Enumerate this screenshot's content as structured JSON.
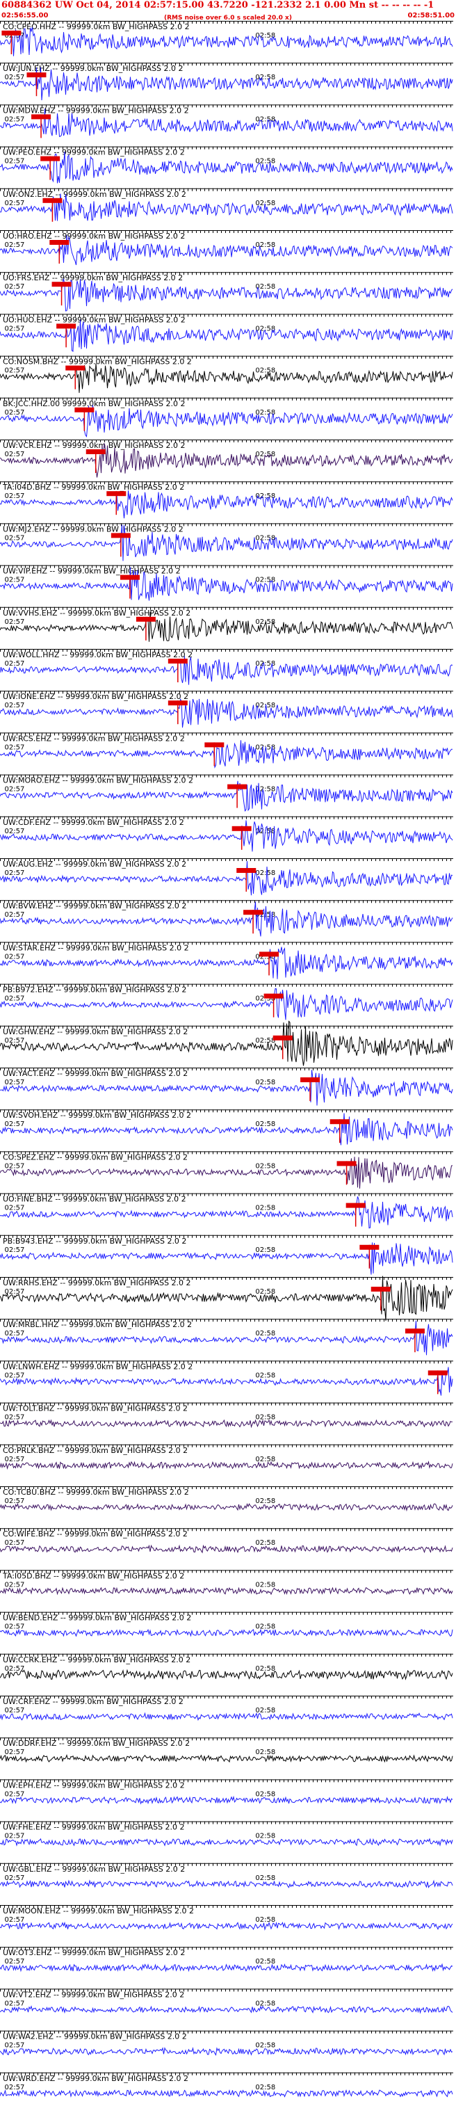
{
  "header": {
    "title": "60884362 UW Oct 04, 2014 02:57:15.00    43.7220 -121.2332  2.1 0.00 Mn st -- -- -- -- -1",
    "start_time": "02:56:55.00",
    "end_time": "02:58:51.00",
    "note": "(RMS noise over 6.0 s scaled 20.0 x)"
  },
  "colors": {
    "blue": "#1a1aff",
    "black": "#000000",
    "purple": "#3a1060",
    "pick": "#e00000",
    "grid": "#000000"
  },
  "chart_data": {
    "type": "line",
    "title": "60884362 UW Oct 04, 2014 02:57:15.00    43.7220 -121.2332  2.1 0.00 Mn st -- -- -- -- -1",
    "x_range": [
      "02:56:55.00",
      "02:58:51.00"
    ],
    "time_labels": [
      "02:57",
      "02:58"
    ],
    "series": [
      {
        "name": "COPREO",
        "label": "CO:CPEO.HHZ -- 99999.0km BW_HIGHPASS 2.0 2",
        "color": "blue",
        "pick_frac": 0.025
      },
      {
        "name": "UWJUN",
        "label": "UW:JUN.EHZ -- 99999.0km BW_HIGHPASS 2.0 2",
        "color": "blue",
        "pick_frac": 0.08
      },
      {
        "name": "UWMDW",
        "label": "UW:MDW.EHZ -- 99999.0km BW_HIGHPASS 2.0 2",
        "color": "blue",
        "pick_frac": 0.09
      },
      {
        "name": "UWPEO",
        "label": "UW:PEO.EHZ -- 99999.0km BW_HIGHPASS 2.0 2",
        "color": "blue",
        "pick_frac": 0.11
      },
      {
        "name": "UWON2",
        "label": "UW:ON2.EHZ -- 99999.0km BW_HIGHPASS 2.0 2",
        "color": "blue",
        "pick_frac": 0.115
      },
      {
        "name": "UOHRO",
        "label": "UO:HRO.EHZ -- 99999.0km BW_HIGHPASS 2.0 2",
        "color": "blue",
        "pick_frac": 0.13
      },
      {
        "name": "UOFRS",
        "label": "UO:FRS.EHZ -- 99999.0km BW_HIGHPASS 2.0 2",
        "color": "blue",
        "pick_frac": 0.135
      },
      {
        "name": "UOHUO",
        "label": "UO:HUO.EHZ -- 99999.0km BW_HIGHPASS 2.0 2",
        "color": "blue",
        "pick_frac": 0.145
      },
      {
        "name": "CONOSM",
        "label": "CO:NOSM.BHZ -- 99999.0km BW_HIGHPASS 2.0 2",
        "color": "black",
        "pick_frac": 0.165
      },
      {
        "name": "BKJCC",
        "label": "BK:JCC.HHZ.00 99999.0km BW_HIGHPASS 2.0 2",
        "color": "blue",
        "pick_frac": 0.185
      },
      {
        "name": "UWVCR",
        "label": "UW:VCR.EHZ -- 99999.0km BW_HIGHPASS 2.0 2",
        "color": "purple",
        "pick_frac": 0.21
      },
      {
        "name": "TAI04D",
        "label": "TA:I04D.BHZ -- 99999.0km BW_HIGHPASS 2.0 2",
        "color": "blue",
        "pick_frac": 0.255
      },
      {
        "name": "UWMJ2",
        "label": "UW:MJ2.EHZ -- 99999.0km BW_HIGHPASS 2.0 2",
        "color": "blue",
        "pick_frac": 0.265
      },
      {
        "name": "UWVIP",
        "label": "UW:VIP.EHZ -- 99999.0km BW_HIGHPASS 2.0 2",
        "color": "blue",
        "pick_frac": 0.285
      },
      {
        "name": "UWVVHS",
        "label": "UW:VVHS.EHZ -- 99999.0km BW_HIGHPASS 2.0 2",
        "color": "black",
        "pick_frac": 0.32
      },
      {
        "name": "UWWOLL",
        "label": "UW:WOLL.HHZ -- 99999.0km BW_HIGHPASS 2.0 2",
        "color": "blue",
        "pick_frac": 0.39
      },
      {
        "name": "UWIONE",
        "label": "UW:IONE.EHZ -- 99999.0km BW_HIGHPASS 2.0 2",
        "color": "blue",
        "pick_frac": 0.39
      },
      {
        "name": "UWRCS",
        "label": "UW:RCS.EHZ -- 99999.0km BW_HIGHPASS 2.0 2",
        "color": "blue",
        "pick_frac": 0.47
      },
      {
        "name": "UWMORO",
        "label": "UW:MORO.EHZ -- 99999.0km BW_HIGHPASS 2.0 2",
        "color": "blue",
        "pick_frac": 0.52
      },
      {
        "name": "UWCDF",
        "label": "UW:CDF.EHZ -- 99999.0km BW_HIGHPASS 2.0 2",
        "color": "blue",
        "pick_frac": 0.53
      },
      {
        "name": "UWAUG",
        "label": "UW:AUG.EHZ -- 99999.0km BW_HIGHPASS 2.0 2",
        "color": "blue",
        "pick_frac": 0.54
      },
      {
        "name": "UWBVW",
        "label": "UW:BVW.EHZ -- 99999.0km BW_HIGHPASS 2.0 2",
        "color": "blue",
        "pick_frac": 0.555
      },
      {
        "name": "UWSTAR",
        "label": "UW:STAR.EHZ -- 99999.0km BW_HIGHPASS 2.0 2",
        "color": "blue",
        "pick_frac": 0.59
      },
      {
        "name": "PBB972",
        "label": "PB:B972.EHZ -- 99999.0km BW_HIGHPASS 2.0 2",
        "color": "blue",
        "pick_frac": 0.6
      },
      {
        "name": "UWGHW",
        "label": "UW:GHW.EHZ -- 99999.0km BW_HIGHPASS 2.0 2",
        "color": "black",
        "pick_frac": 0.62
      },
      {
        "name": "UWYACT",
        "label": "UW:YACT.EHZ -- 99999.0km BW_HIGHPASS 2.0 2",
        "color": "blue",
        "pick_frac": 0.68
      },
      {
        "name": "UWSVOH",
        "label": "UW:SVOH.EHZ -- 99999.0km BW_HIGHPASS 2.0 2",
        "color": "blue",
        "pick_frac": 0.745
      },
      {
        "name": "COSPE",
        "label": "CO:SPEZ.EHZ -- 99999.0km BW_HIGHPASS 2.0 2",
        "color": "purple",
        "pick_frac": 0.76
      },
      {
        "name": "UOFINE",
        "label": "UO:FINE.BHZ -- 99999.0km BW_HIGHPASS 2.0 2",
        "color": "blue",
        "pick_frac": 0.78
      },
      {
        "name": "PBB943",
        "label": "PB:B943.EHZ -- 99999.0km BW_HIGHPASS 2.0 2",
        "color": "blue",
        "pick_frac": 0.81
      },
      {
        "name": "UWRRHS",
        "label": "UW:RRHS.EHZ -- 99999.0km BW_HIGHPASS 2.0 2",
        "color": "black",
        "pick_frac": 0.835
      },
      {
        "name": "UWMRBL",
        "label": "UW:MRBL.HHZ -- 99999.0km BW_HIGHPASS 2.0 2",
        "color": "blue",
        "pick_frac": 0.91
      },
      {
        "name": "UWLNWH",
        "label": "UW:LNWH.EHZ -- 99999.0km BW_HIGHPASS 2.0 2",
        "color": "blue",
        "pick_frac": 0.96
      },
      {
        "name": "UWTOLT",
        "label": "UW:TOLT.BHZ -- 99999.0km BW_HIGHPASS 2.0 2",
        "color": "purple"
      },
      {
        "name": "COPRLK",
        "label": "CO:PRLK.BHZ -- 99999.0km BW_HIGHPASS 2.0 2",
        "color": "purple"
      },
      {
        "name": "COTCBU",
        "label": "CO:TCBU.BHZ -- 99999.0km BW_HIGHPASS 2.0 2",
        "color": "purple"
      },
      {
        "name": "COWIFE",
        "label": "CO:WIFE.BHZ -- 99999.0km BW_HIGHPASS 2.0 2",
        "color": "purple"
      },
      {
        "name": "TAI05D",
        "label": "TA:I05D.BHZ -- 99999.0km BW_HIGHPASS 2.0 2",
        "color": "purple"
      },
      {
        "name": "UWBEND",
        "label": "UW:BEND.EHZ -- 99999.0km BW_HIGHPASS 2.0 2",
        "color": "blue"
      },
      {
        "name": "UWCCRK",
        "label": "UW:CCRK.EHZ -- 99999.0km BW_HIGHPASS 2.0 2",
        "color": "black"
      },
      {
        "name": "UWCRF",
        "label": "UW:CRF.EHZ -- 99999.0km BW_HIGHPASS 2.0 2",
        "color": "blue"
      },
      {
        "name": "UWDDRF",
        "label": "UW:DDRF.EHZ -- 99999.0km BW_HIGHPASS 2.0 2",
        "color": "black"
      },
      {
        "name": "UWEPH",
        "label": "UW:EPH.EHZ -- 99999.0km BW_HIGHPASS 2.0 2",
        "color": "blue"
      },
      {
        "name": "UWFHE",
        "label": "UW:FHE.EHZ -- 99999.0km BW_HIGHPASS 2.0 2",
        "color": "blue"
      },
      {
        "name": "UWGBL",
        "label": "UW:GBL.EHZ -- 99999.0km BW_HIGHPASS 2.0 2",
        "color": "blue"
      },
      {
        "name": "UWMOON",
        "label": "UW:MOON.EHZ -- 99999.0km BW_HIGHPASS 2.0 2",
        "color": "blue"
      },
      {
        "name": "UWOT3",
        "label": "UW:OT3.EHZ -- 99999.0km BW_HIGHPASS 2.0 2",
        "color": "blue"
      },
      {
        "name": "UWVT2",
        "label": "UW:VT2.EHZ -- 99999.0km BW_HIGHPASS 2.0 2",
        "color": "blue"
      },
      {
        "name": "UWWA2",
        "label": "UW:WA2.EHZ -- 99999.0km BW_HIGHPASS 2.0 2",
        "color": "blue"
      },
      {
        "name": "UWWRD",
        "label": "UW:WRD.EHZ -- 99999.0km BW_HIGHPASS 2.0 2",
        "color": "blue"
      }
    ]
  }
}
